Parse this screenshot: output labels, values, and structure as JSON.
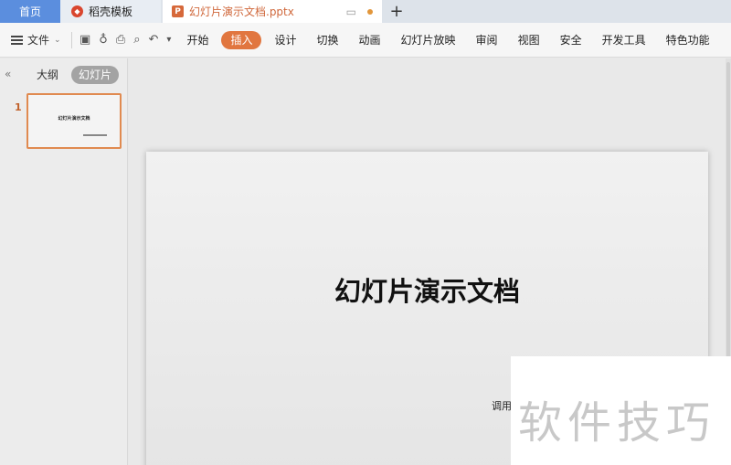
{
  "tabs": {
    "home": "首页",
    "templates": "稻壳模板",
    "document": "幻灯片演示文档.pptx",
    "new_tab": "+"
  },
  "menubar": {
    "file": "文件",
    "ribbon_tabs": [
      "开始",
      "插入",
      "设计",
      "切换",
      "动画",
      "幻灯片放映",
      "审阅",
      "视图",
      "安全",
      "开发工具",
      "特色功能"
    ],
    "active_tab": "插入"
  },
  "left_pane": {
    "collapse": "«",
    "outline_tab": "大纲",
    "slides_tab": "幻灯片",
    "slide_number": "1",
    "thumb_title": "幻灯片演示文档"
  },
  "slide": {
    "title": "幻灯片演示文档",
    "subtitle": "调用"
  },
  "watermark": "软件技巧",
  "colors": {
    "accent": "#e1763f",
    "home_tab": "#5b8ede",
    "doc_tab_text": "#d0683c"
  }
}
